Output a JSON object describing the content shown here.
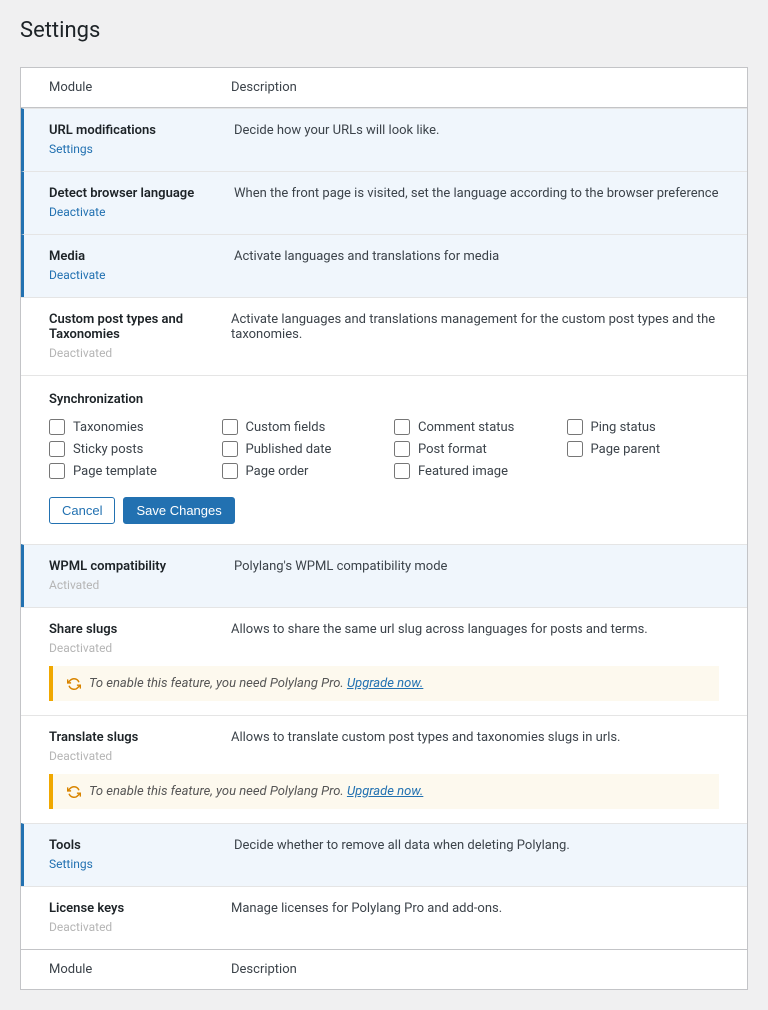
{
  "page_title": "Settings",
  "headers": {
    "module": "Module",
    "description": "Description"
  },
  "modules": {
    "url": {
      "title": "URL modifications",
      "action": "Settings",
      "desc": "Decide how your URLs will look like."
    },
    "browser": {
      "title": "Detect browser language",
      "action": "Deactivate",
      "desc": "When the front page is visited, set the language according to the browser preference"
    },
    "media": {
      "title": "Media",
      "action": "Deactivate",
      "desc": "Activate languages and translations for media"
    },
    "cpt": {
      "title": "Custom post types and Taxonomies",
      "status": "Deactivated",
      "desc": "Activate languages and translations management for the custom post types and the taxonomies."
    },
    "wpml": {
      "title": "WPML compatibility",
      "status": "Activated",
      "desc": "Polylang's WPML compatibility mode"
    },
    "share_slugs": {
      "title": "Share slugs",
      "status": "Deactivated",
      "desc": "Allows to share the same url slug across languages for posts and terms."
    },
    "translate_slugs": {
      "title": "Translate slugs",
      "status": "Deactivated",
      "desc": "Allows to translate custom post types and taxonomies slugs in urls."
    },
    "tools": {
      "title": "Tools",
      "action": "Settings",
      "desc": "Decide whether to remove all data when deleting Polylang."
    },
    "license": {
      "title": "License keys",
      "status": "Deactivated",
      "desc": "Manage licenses for Polylang Pro and add-ons."
    }
  },
  "sync": {
    "title": "Synchronization",
    "options": [
      "Taxonomies",
      "Custom fields",
      "Comment status",
      "Ping status",
      "Sticky posts",
      "Published date",
      "Post format",
      "Page parent",
      "Page template",
      "Page order",
      "Featured image"
    ],
    "cancel": "Cancel",
    "save": "Save Changes"
  },
  "upgrade_notice": {
    "text": "To enable this feature, you need Polylang Pro. ",
    "link": "Upgrade now."
  }
}
